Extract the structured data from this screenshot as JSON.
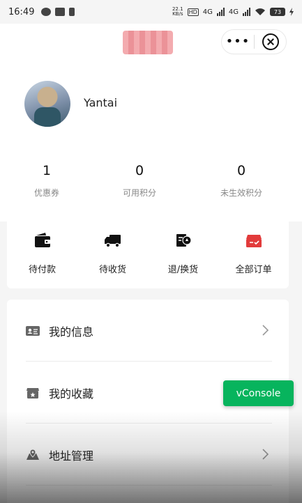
{
  "status_bar": {
    "time": "16:49",
    "net_speed": "22.1\nKB/s",
    "hd_label": "HD",
    "network_1": "4G",
    "network_2": "4G",
    "battery": "73"
  },
  "header": {
    "menu_more": "•••",
    "close_icon": "close-circle-icon"
  },
  "profile": {
    "username": "Yantai"
  },
  "stats": [
    {
      "value": "1",
      "label": "优惠券"
    },
    {
      "value": "0",
      "label": "可用积分"
    },
    {
      "value": "0",
      "label": "未生效积分"
    }
  ],
  "orders": [
    {
      "label": "待付款",
      "icon": "wallet-icon"
    },
    {
      "label": "待收货",
      "icon": "truck-icon"
    },
    {
      "label": "退/换货",
      "icon": "return-icon"
    },
    {
      "label": "全部订单",
      "icon": "order-box-icon"
    }
  ],
  "menu": [
    {
      "label": "我的信息",
      "icon": "id-card-icon"
    },
    {
      "label": "我的收藏",
      "icon": "favorite-box-icon"
    },
    {
      "label": "地址管理",
      "icon": "map-pin-icon"
    }
  ],
  "vconsole": {
    "label": "vConsole",
    "color": "#07b45d"
  },
  "colors": {
    "order_accent": "#e23b3b",
    "text": "#222222",
    "muted": "#888888"
  }
}
